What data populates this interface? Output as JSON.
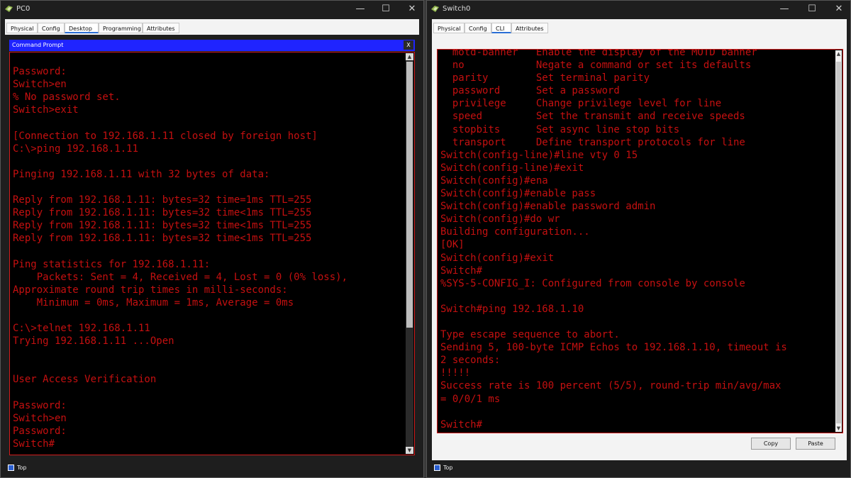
{
  "pc0": {
    "title": "PC0",
    "tabs": [
      "Physical",
      "Config",
      "Desktop",
      "Programming",
      "Attributes"
    ],
    "active_tab": "Desktop",
    "cmd_title": "Command Prompt",
    "close_label": "X",
    "terminal_text": "\nPassword:\nSwitch>en\n% No password set.\nSwitch>exit\n\n[Connection to 192.168.1.11 closed by foreign host]\nC:\\>ping 192.168.1.11\n\nPinging 192.168.1.11 with 32 bytes of data:\n\nReply from 192.168.1.11: bytes=32 time=1ms TTL=255\nReply from 192.168.1.11: bytes=32 time<1ms TTL=255\nReply from 192.168.1.11: bytes=32 time<1ms TTL=255\nReply from 192.168.1.11: bytes=32 time<1ms TTL=255\n\nPing statistics for 192.168.1.11:\n    Packets: Sent = 4, Received = 4, Lost = 0 (0% loss),\nApproximate round trip times in milli-seconds:\n    Minimum = 0ms, Maximum = 1ms, Average = 0ms\n\nC:\\>telnet 192.168.1.11\nTrying 192.168.1.11 ...Open\n\n\nUser Access Verification\n\nPassword:\nSwitch>en\nPassword:\nSwitch#",
    "top_label": "Top"
  },
  "sw0": {
    "title": "Switch0",
    "tabs": [
      "Physical",
      "Config",
      "CLI",
      "Attributes"
    ],
    "active_tab": "CLI",
    "terminal_text": "  motd-banner   Enable the display of the MOTD banner\n  no            Negate a command or set its defaults\n  parity        Set terminal parity\n  password      Set a password\n  privilege     Change privilege level for line\n  speed         Set the transmit and receive speeds\n  stopbits      Set async line stop bits\n  transport     Define transport protocols for line\nSwitch(config-line)#line vty 0 15\nSwitch(config-line)#exit\nSwitch(config)#ena\nSwitch(config)#enable pass\nSwitch(config)#enable password admin\nSwitch(config)#do wr\nBuilding configuration...\n[OK]\nSwitch(config)#exit\nSwitch#\n%SYS-5-CONFIG_I: Configured from console by console\n\nSwitch#ping 192.168.1.10\n\nType escape sequence to abort.\nSending 5, 100-byte ICMP Echos to 192.168.1.10, timeout is\n2 seconds:\n!!!!!\nSuccess rate is 100 percent (5/5), round-trip min/avg/max\n= 0/0/1 ms\n\nSwitch#",
    "copy_label": "Copy",
    "paste_label": "Paste",
    "top_label": "Top"
  },
  "window_controls": {
    "minimize": "—",
    "maximize": "☐",
    "close": "✕"
  },
  "colors": {
    "terminal_text": "#c51010",
    "terminal_bg": "#000000",
    "cmd_header": "#1f24ff",
    "border": "#d21c1c"
  }
}
